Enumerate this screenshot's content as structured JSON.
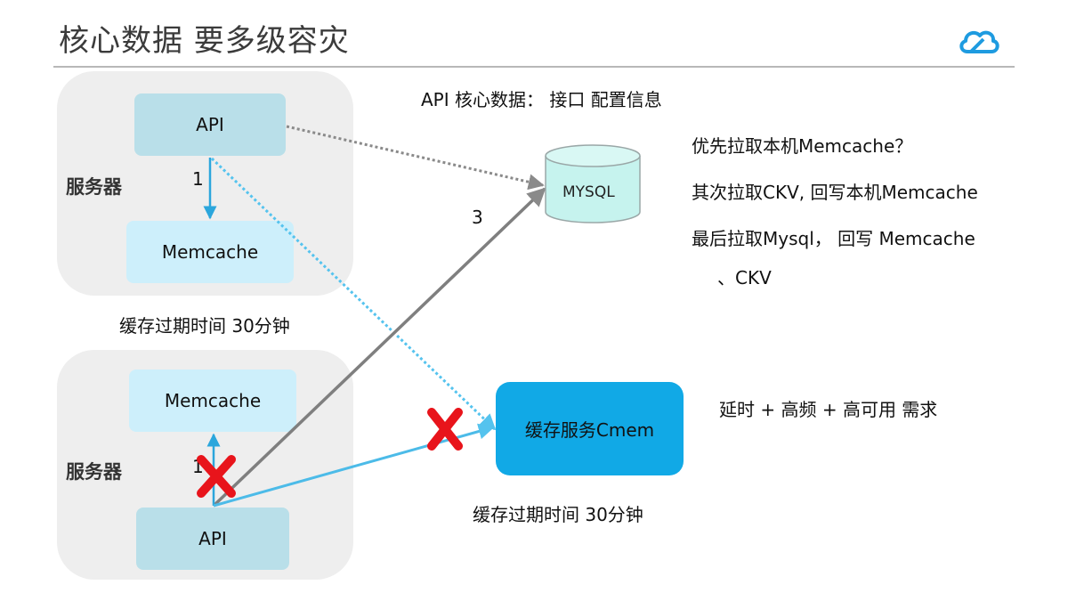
{
  "header": {
    "title": "核心数据 要多级容灾",
    "logo_icon": "cloud-logo-icon"
  },
  "top_server": {
    "label": "服务器",
    "api": "API",
    "memcache": "Memcache",
    "step": "1",
    "expire": "缓存过期时间 30分钟"
  },
  "bottom_server": {
    "label": "服务器",
    "api": "API",
    "memcache": "Memcache",
    "step": "1"
  },
  "mysql": {
    "label": "MYSQL",
    "step": "3"
  },
  "cmem": {
    "label": "缓存服务Cmem",
    "expire": "缓存过期时间 30分钟"
  },
  "notes": {
    "core_data": "API 核心数据： 接口 配置信息",
    "line1": "优先拉取本机Memcache？",
    "line2": "其次拉取CKV, 回写本机Memcache",
    "line3": "最后拉取Mysql， 回写 Memcache",
    "line4": "、CKV",
    "requirement": "延时 + 高频 + 高可用  需求"
  },
  "colors": {
    "arrow_blue": "#2ba6dc",
    "arrow_gray": "#808080",
    "dotted_blue": "#55c3ee",
    "fail_red": "#e8141b",
    "db_fill": "#c6f3ee"
  }
}
